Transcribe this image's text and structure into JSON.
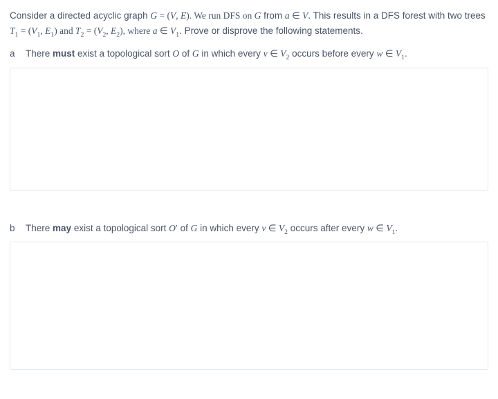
{
  "intro": {
    "t1": "Consider a directed acyclic graph ",
    "m1": "G",
    "t2": " = (",
    "m2": "V",
    "t3": ", ",
    "m3": "E",
    "t4": "). We run DFS on ",
    "m4": "G",
    "t5": " from ",
    "m5": "a",
    "t6": " ∈ ",
    "m6": "V",
    "t7": ". This results in a DFS forest with two trees ",
    "m7": "T",
    "s7": "1",
    "t8": " = (",
    "m8": "V",
    "s8": "1",
    "t9": ", ",
    "m9": "E",
    "s9": "1",
    "t10": ") and ",
    "m10": "T",
    "s10": "2",
    "t11": " = (",
    "m11": "V",
    "s11": "2",
    "t12": ", ",
    "m12": "E",
    "s12": "2",
    "t13": "), where ",
    "m13": "a",
    "t14": " ∈ ",
    "m14": "V",
    "s14": "1",
    "t15": ". Prove or disprove the following statements."
  },
  "part_a": {
    "label": "a",
    "t1": "There ",
    "bold": "must",
    "t2": " exist a topological sort ",
    "m1": "O",
    "t3": " of ",
    "m2": "G",
    "t4": " in which every ",
    "m3": "v",
    "t5": " ∈ ",
    "m4": "V",
    "s4": "2",
    "t6": " occurs before every ",
    "m5": "w",
    "t7": " ∈ ",
    "m6": "V",
    "s6": "1",
    "t8": "."
  },
  "part_b": {
    "label": "b",
    "t1": "There ",
    "bold": "may",
    "t2": " exist a topological sort ",
    "m1": "O",
    "mp": "′",
    "t3": " of ",
    "m2": "G",
    "t4": " in which every ",
    "m3": "v",
    "t5": " ∈ ",
    "m4": "V",
    "s4": "2",
    "t6": " occurs after every ",
    "m5": "w",
    "t7": " ∈ ",
    "m6": "V",
    "s6": "1",
    "t8": "."
  }
}
